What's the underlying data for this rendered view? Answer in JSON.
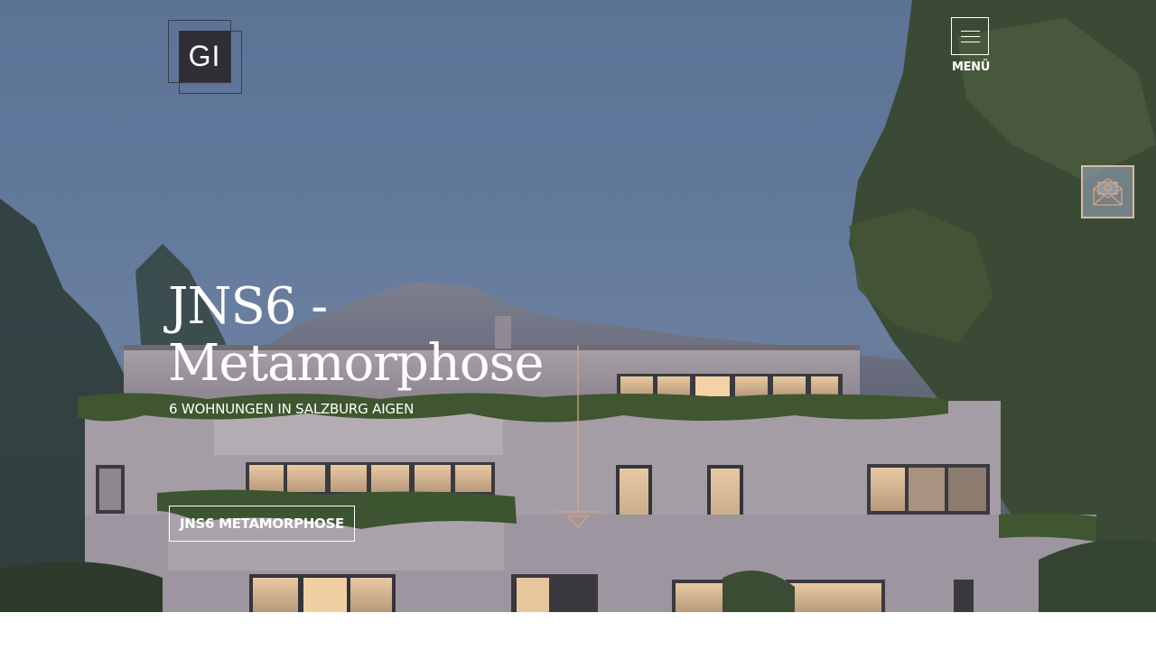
{
  "logo": {
    "text": "GI"
  },
  "menu": {
    "label": "MENÜ",
    "icon": "hamburger-icon"
  },
  "contact": {
    "icon": "mail-icon"
  },
  "hero": {
    "title_line1": "JNS6 -",
    "title_line2": "Metamorphose",
    "subtitle": "6 WOHNUNGEN IN SALZBURG AIGEN",
    "cta_label": "JNS6 METAMORPHOSE",
    "scroll_icon": "arrow-down-icon"
  },
  "colors": {
    "accent": "#d9a57c",
    "logo_bg": "#2f2f33",
    "text": "#ffffff"
  }
}
